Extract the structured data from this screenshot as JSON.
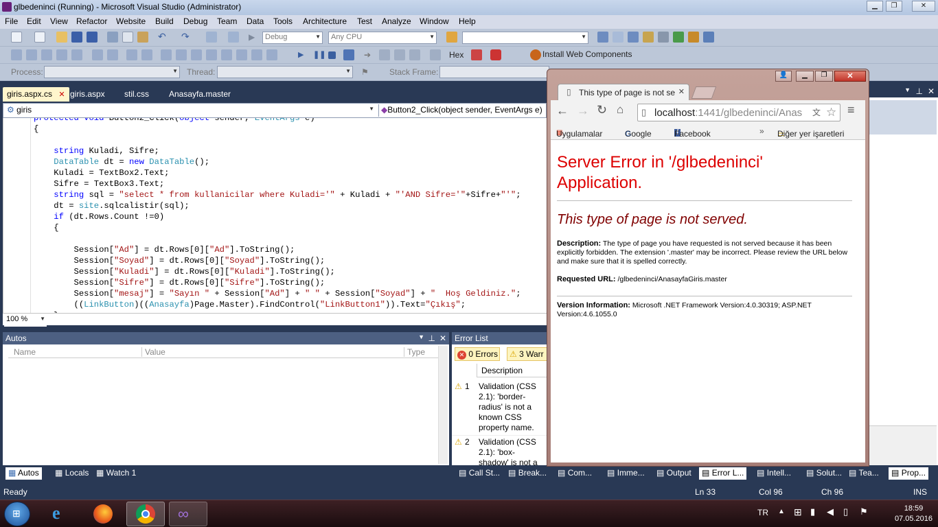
{
  "vs": {
    "title": "glbedeninci (Running) - Microsoft Visual Studio (Administrator)",
    "menu": [
      "File",
      "Edit",
      "View",
      "Refactor",
      "Website",
      "Build",
      "Debug",
      "Team",
      "Data",
      "Tools",
      "Architecture",
      "Test",
      "Analyze",
      "Window",
      "Help"
    ],
    "toolbar": {
      "config": "Debug",
      "platform": "Any CPU",
      "hex_label": "Hex",
      "install_web_components": "Install Web Components",
      "process_label": "Process:",
      "thread_label": "Thread:",
      "stack_frame_label": "Stack Frame:"
    },
    "doc_tabs": [
      {
        "label": "giris.aspx.cs",
        "active": true
      },
      {
        "label": "giris.aspx",
        "active": false
      },
      {
        "label": "stil.css",
        "active": false
      },
      {
        "label": "Anasayfa.master",
        "active": false
      }
    ],
    "nav": {
      "class_combo": "giris",
      "member_combo": "Button2_Click(object sender, EventArgs e)"
    },
    "zoom": "100 %",
    "autos": {
      "title": "Autos",
      "columns": [
        "Name",
        "Value",
        "Type"
      ]
    },
    "autos_tabs": [
      "Autos",
      "Locals",
      "Watch 1"
    ],
    "error_list": {
      "title": "Error List",
      "errors_btn": "0 Errors",
      "warnings_btn": "3 Warr",
      "column_description": "Description",
      "rows": [
        {
          "num": "1",
          "text": "Validation (CSS 2.1): 'border-radius' is not a known CSS property name."
        },
        {
          "num": "2",
          "text": "Validation (CSS 2.1): 'box-shadow' is not a"
        }
      ]
    },
    "bottom_tabs": [
      "Call St...",
      "Break...",
      "Com...",
      "Imme...",
      "Output",
      "Error L...",
      "Intell...",
      "Solut...",
      "Tea...",
      "Prop..."
    ],
    "status": {
      "ready": "Ready",
      "ln": "Ln 33",
      "col": "Col 96",
      "ch": "Ch 96",
      "ins": "INS"
    }
  },
  "chrome": {
    "tab_title": "This type of page is not se",
    "url_host": "localhost",
    "url_rest": ":1441/glbedeninci/Anas",
    "bookmarks": {
      "apps": "Uygulamalar",
      "google": "Google",
      "facebook": "Facebook",
      "more": "»",
      "other": "Diğer yer işaretleri"
    },
    "page": {
      "heading": "Server Error in '/glbedeninci' Application.",
      "subheading": "This type of page is not served.",
      "description_label": "Description:",
      "description_text": "The type of page you have requested is not served because it has been explicitly forbidden.  The extension '.master' may be incorrect.   Please review the URL below and make sure that it is spelled correctly.",
      "requested_url_label": "Requested URL:",
      "requested_url": "/glbedeninci/AnasayfaGiris.master",
      "version_label": "Version Information:",
      "version_text": "Microsoft .NET Framework Version:4.0.30319; ASP.NET Version:4.6.1055.0"
    }
  },
  "taskbar": {
    "lang": "TR",
    "time": "18:59",
    "date": "07.05.2016"
  },
  "colors": {
    "vs_chrome": "#293955",
    "error_red": "#dd0000",
    "subheading": "#800000"
  }
}
